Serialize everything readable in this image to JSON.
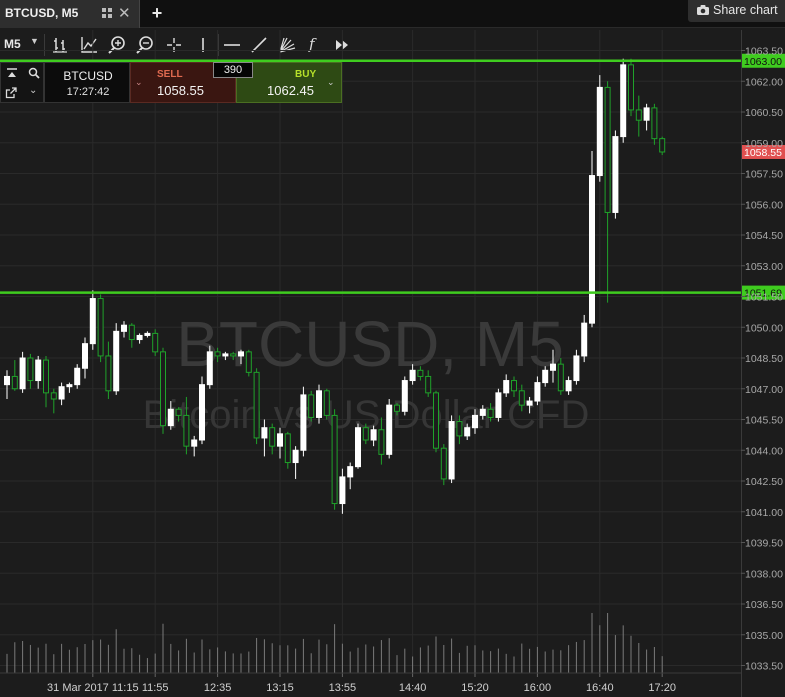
{
  "tab": {
    "title": "BTCUSD, M5",
    "add_label": "+"
  },
  "share": {
    "label": "Share chart",
    "icon": "camera-icon"
  },
  "toolbar": {
    "timeframe": "M5",
    "icons": [
      "chart-type-icon",
      "indicators-icon",
      "zoom-in-icon",
      "zoom-out-icon",
      "crosshair-icon",
      "vertical-line-icon",
      "horizontal-line-icon",
      "trend-line-icon",
      "fibonacci-fan-icon",
      "function-icon",
      "fast-forward-icon"
    ],
    "fx_label": "f"
  },
  "trade_panel": {
    "symbol": "BTCUSD",
    "time": "17:27:42",
    "sell_label": "SELL",
    "sell_price": "1058.55",
    "spread": "390",
    "buy_label": "BUY",
    "buy_price": "1062.45"
  },
  "colors": {
    "background": "#1c1c1c",
    "grid": "#2a2a2a",
    "bull": "#ffffff",
    "bear": "#1fa22a",
    "level_line": "#3fcc1f",
    "sell_tag": "#e05050",
    "volume": "#7a7a7a"
  },
  "chart_data": {
    "type": "candlestick",
    "title": "BTCUSD, M5",
    "subtitle": "Bitcoin vs US Dollar CFD",
    "ylim": [
      1032.6,
      1064.5
    ],
    "y_ticks": [
      "1063.50",
      "1062.00",
      "1060.50",
      "1059.00",
      "1057.50",
      "1056.00",
      "1054.50",
      "1053.00",
      "1051.50",
      "1050.00",
      "1048.50",
      "1047.00",
      "1045.50",
      "1044.00",
      "1042.50",
      "1041.00",
      "1039.50",
      "1038.00",
      "1036.50",
      "1035.00",
      "1033.50"
    ],
    "x_ticks": [
      {
        "label": "31 Mar 2017 11:15",
        "bar": 11
      },
      {
        "label": "11:55",
        "bar": 19
      },
      {
        "label": "12:35",
        "bar": 27
      },
      {
        "label": "13:15",
        "bar": 35
      },
      {
        "label": "13:55",
        "bar": 43
      },
      {
        "label": "14:40",
        "bar": 52
      },
      {
        "label": "15:20",
        "bar": 60
      },
      {
        "label": "16:00",
        "bar": 68
      },
      {
        "label": "16:40",
        "bar": 76
      },
      {
        "label": "17:20",
        "bar": 84
      }
    ],
    "levels": [
      {
        "value": 1063.0,
        "label": "1063.00"
      },
      {
        "value": 1051.69,
        "label": "1051.69"
      }
    ],
    "current_price": {
      "value": 1058.55,
      "label": "1058.55"
    },
    "grid": true,
    "candles": [
      [
        1047.2,
        1047.9,
        1046.5,
        1047.6
      ],
      [
        1047.6,
        1048.4,
        1046.9,
        1047.0
      ],
      [
        1047.0,
        1048.8,
        1046.8,
        1048.5
      ],
      [
        1048.5,
        1048.7,
        1047.0,
        1047.4
      ],
      [
        1047.4,
        1048.6,
        1047.0,
        1048.4
      ],
      [
        1048.4,
        1048.6,
        1046.1,
        1046.8
      ],
      [
        1046.8,
        1047.0,
        1045.8,
        1046.5
      ],
      [
        1046.5,
        1047.3,
        1046.2,
        1047.1
      ],
      [
        1047.1,
        1047.3,
        1046.8,
        1047.2
      ],
      [
        1047.2,
        1048.2,
        1047.0,
        1048.0
      ],
      [
        1048.0,
        1049.5,
        1047.5,
        1049.2
      ],
      [
        1049.2,
        1051.8,
        1048.9,
        1051.4
      ],
      [
        1051.4,
        1051.6,
        1048.3,
        1048.6
      ],
      [
        1048.6,
        1049.3,
        1046.5,
        1046.9
      ],
      [
        1046.9,
        1050.2,
        1046.7,
        1049.8
      ],
      [
        1049.8,
        1050.3,
        1049.5,
        1050.1
      ],
      [
        1050.1,
        1050.2,
        1049.0,
        1049.4
      ],
      [
        1049.4,
        1049.7,
        1049.2,
        1049.6
      ],
      [
        1049.6,
        1049.8,
        1049.5,
        1049.7
      ],
      [
        1049.7,
        1049.9,
        1048.6,
        1048.8
      ],
      [
        1048.8,
        1049.0,
        1044.8,
        1045.2
      ],
      [
        1045.2,
        1046.4,
        1045.0,
        1046.0
      ],
      [
        1046.0,
        1046.1,
        1045.4,
        1045.7
      ],
      [
        1045.7,
        1046.6,
        1043.8,
        1044.2
      ],
      [
        1044.2,
        1044.7,
        1043.7,
        1044.5
      ],
      [
        1044.5,
        1047.6,
        1044.3,
        1047.2
      ],
      [
        1047.2,
        1049.1,
        1047.0,
        1048.8
      ],
      [
        1048.8,
        1049.0,
        1048.3,
        1048.6
      ],
      [
        1048.6,
        1048.8,
        1048.4,
        1048.7
      ],
      [
        1048.7,
        1048.8,
        1048.4,
        1048.6
      ],
      [
        1048.6,
        1048.9,
        1048.2,
        1048.8
      ],
      [
        1048.8,
        1048.9,
        1047.6,
        1047.8
      ],
      [
        1047.8,
        1048.0,
        1044.3,
        1044.6
      ],
      [
        1044.6,
        1045.5,
        1043.7,
        1045.1
      ],
      [
        1045.1,
        1045.3,
        1043.8,
        1044.2
      ],
      [
        1044.2,
        1045.1,
        1043.6,
        1044.8
      ],
      [
        1044.8,
        1044.9,
        1043.1,
        1043.4
      ],
      [
        1043.4,
        1044.2,
        1042.6,
        1044.0
      ],
      [
        1044.0,
        1047.1,
        1043.7,
        1046.7
      ],
      [
        1046.7,
        1046.9,
        1045.4,
        1045.6
      ],
      [
        1045.6,
        1047.2,
        1045.3,
        1046.9
      ],
      [
        1046.9,
        1047.0,
        1045.5,
        1045.7
      ],
      [
        1045.7,
        1046.0,
        1041.1,
        1041.4
      ],
      [
        1041.4,
        1043.1,
        1040.9,
        1042.7
      ],
      [
        1042.7,
        1043.4,
        1042.1,
        1043.2
      ],
      [
        1043.2,
        1045.3,
        1043.1,
        1045.1
      ],
      [
        1045.1,
        1045.3,
        1044.3,
        1044.5
      ],
      [
        1044.5,
        1045.2,
        1044.2,
        1045.0
      ],
      [
        1045.0,
        1045.6,
        1043.3,
        1043.8
      ],
      [
        1043.8,
        1046.5,
        1043.6,
        1046.2
      ],
      [
        1046.2,
        1046.3,
        1045.7,
        1045.9
      ],
      [
        1045.9,
        1047.6,
        1045.7,
        1047.4
      ],
      [
        1047.4,
        1048.2,
        1047.2,
        1047.9
      ],
      [
        1047.9,
        1048.1,
        1047.4,
        1047.6
      ],
      [
        1047.6,
        1047.9,
        1046.6,
        1046.8
      ],
      [
        1046.8,
        1046.9,
        1043.9,
        1044.1
      ],
      [
        1044.1,
        1044.3,
        1042.3,
        1042.6
      ],
      [
        1042.6,
        1045.7,
        1042.4,
        1045.4
      ],
      [
        1045.4,
        1045.7,
        1044.3,
        1044.7
      ],
      [
        1044.7,
        1045.3,
        1044.5,
        1045.1
      ],
      [
        1045.1,
        1046.0,
        1044.8,
        1045.7
      ],
      [
        1045.7,
        1046.2,
        1045.5,
        1046.0
      ],
      [
        1046.0,
        1046.3,
        1045.4,
        1045.6
      ],
      [
        1045.6,
        1047.0,
        1045.4,
        1046.8
      ],
      [
        1046.8,
        1047.7,
        1046.6,
        1047.4
      ],
      [
        1047.4,
        1047.6,
        1046.6,
        1046.9
      ],
      [
        1046.9,
        1047.2,
        1045.9,
        1046.2
      ],
      [
        1046.2,
        1046.6,
        1045.8,
        1046.4
      ],
      [
        1046.4,
        1047.6,
        1046.2,
        1047.3
      ],
      [
        1047.3,
        1048.1,
        1047.1,
        1047.9
      ],
      [
        1047.9,
        1048.9,
        1047.3,
        1048.2
      ],
      [
        1048.2,
        1048.5,
        1046.7,
        1046.9
      ],
      [
        1046.9,
        1047.6,
        1046.7,
        1047.4
      ],
      [
        1047.4,
        1048.9,
        1047.2,
        1048.6
      ],
      [
        1048.6,
        1050.6,
        1048.3,
        1050.2
      ],
      [
        1050.2,
        1058.6,
        1050.0,
        1057.4
      ],
      [
        1057.4,
        1062.3,
        1057.1,
        1061.7
      ],
      [
        1061.7,
        1062.0,
        1051.2,
        1055.6
      ],
      [
        1055.6,
        1059.6,
        1055.3,
        1059.3
      ],
      [
        1059.3,
        1063.1,
        1059.0,
        1062.8
      ],
      [
        1062.8,
        1063.1,
        1060.3,
        1060.6
      ],
      [
        1060.6,
        1061.3,
        1059.3,
        1060.1
      ],
      [
        1060.1,
        1060.9,
        1059.6,
        1060.7
      ],
      [
        1060.7,
        1060.9,
        1058.9,
        1059.2
      ],
      [
        1059.2,
        1059.3,
        1058.4,
        1058.55
      ]
    ]
  }
}
